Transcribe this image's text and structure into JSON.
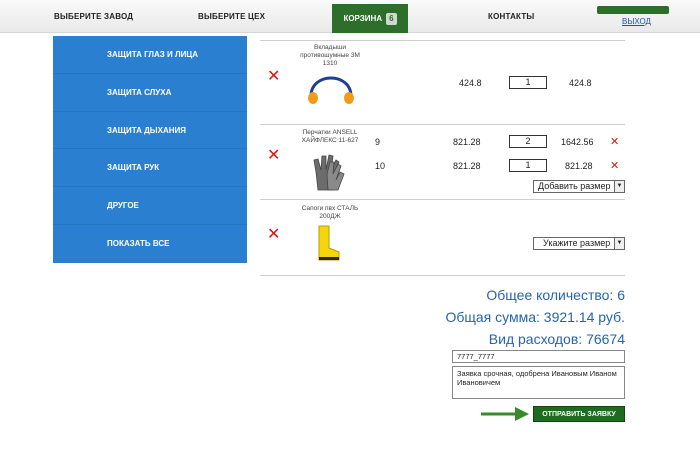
{
  "nav": {
    "items": [
      "ВЫБЕРИТЕ ЗАВОД",
      "ВЫБЕРИТЕ ЦЕХ",
      "КОНТАКТЫ"
    ],
    "cart_label": "КОРЗИНА",
    "cart_count": "6",
    "logout": "ВЫХОД"
  },
  "sidebar": {
    "items": [
      "ЗАЩИТА ГЛАЗ И ЛИЦА",
      "ЗАЩИТА СЛУХА",
      "ЗАЩИТА ДЫХАНИЯ",
      "ЗАЩИТА РУК",
      "ДРУГОЕ",
      "ПОКАЗАТЬ ВСЕ"
    ]
  },
  "cart": {
    "items": [
      {
        "name": "Вкладыши противошумные 3М 1310",
        "icon": "earplugs-icon",
        "rows": [
          {
            "size": "",
            "price": "424.8",
            "qty": "1",
            "sum": "424.8"
          }
        ]
      },
      {
        "name": "Перчатки ANSELL ХАЙФЛЕКС 11-627",
        "icon": "gloves-icon",
        "rows": [
          {
            "size": "9",
            "price": "821.28",
            "qty": "2",
            "sum": "1642.56"
          },
          {
            "size": "10",
            "price": "821.28",
            "qty": "1",
            "sum": "821.28"
          }
        ],
        "add_size": "Добавить размер"
      },
      {
        "name": "Сапоги пвх СТАЛЬ 200ДЖ",
        "icon": "boots-icon",
        "select_size": "Укажите размер"
      }
    ]
  },
  "summary": {
    "total_qty": "Общее количество: 6",
    "total_sum": "Общая сумма: 3921.14 руб.",
    "expense_type": "Вид расходов: 76674"
  },
  "form": {
    "code_value": "7777_7777",
    "comment_value": "Заявка срочная, одобрена Ивановым Иваном Ивановичем",
    "submit_label": "ОТПРАВИТЬ ЗАЯВКУ"
  },
  "colors": {
    "accent_green": "#2d6e2a",
    "sidebar_blue": "#2b7fd1",
    "delete_red": "#e01414",
    "summary_blue": "#2664ac"
  }
}
